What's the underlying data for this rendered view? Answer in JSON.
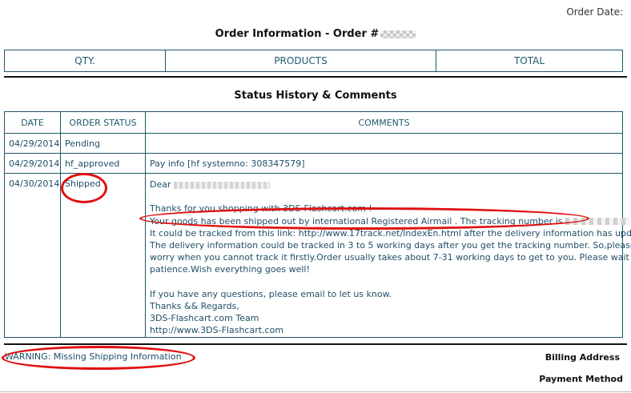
{
  "header": {
    "order_date_label": "Order Date:",
    "order_title": "Order Information - Order #"
  },
  "products_table": {
    "columns": [
      "QTY.",
      "PRODUCTS",
      "TOTAL"
    ]
  },
  "status_section": {
    "title": "Status History & Comments",
    "columns": [
      "DATE",
      "ORDER STATUS",
      "COMMENTS"
    ],
    "rows": [
      {
        "date": "04/29/2014",
        "status": "Pending",
        "comment": ""
      },
      {
        "date": "04/29/2014",
        "status": "hf_approved",
        "comment": "Pay info [hf systemno: 308347579]"
      },
      {
        "date": "04/30/2014",
        "status": "Shipped"
      }
    ],
    "shipped_comment": {
      "greeting": "Dear",
      "line_thanks": "Thanks for you shopping with 3DS-Flashcart.com !",
      "line_shipped": "Your goods has been shipped out by international Registered Airmail . The tracking number is",
      "line_track_link": "It could be tracked from this link: http://www.17track.net/IndexEn.html after the delivery information has updated .",
      "line_delivery_1": "The delivery information could be tracked in 3 to 5 working days after you get the tracking number. So,please don't",
      "line_delivery_2": "worry when you cannot track it firstly.Order usually takes about 7-31 working days to get to you. Please wait with",
      "line_delivery_3": "patience.Wish everything goes well!",
      "line_questions": "If you have any questions, please email to let us know.",
      "line_thanks_regards": "Thanks && Regards,",
      "line_team": "3DS-Flashcart.com Team",
      "line_site": "http://www.3DS-Flashcart.com"
    }
  },
  "footer": {
    "warning": "WARNING: Missing Shipping Information",
    "billing_address": "Billing Address",
    "payment_method": "Payment Method"
  },
  "annotation_color": "#e01010"
}
